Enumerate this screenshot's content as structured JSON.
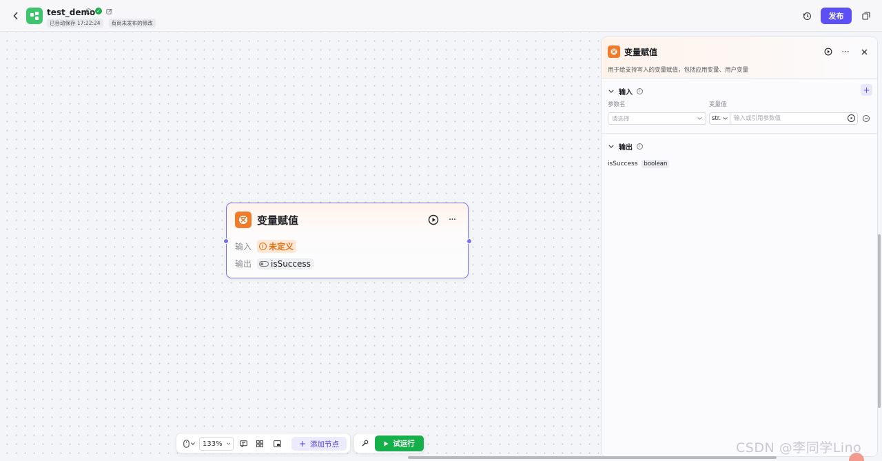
{
  "header": {
    "title": "test_demo",
    "autosave": "已自动保存 17:22:24",
    "unpublished": "有尚未发布的修改",
    "publish_label": "发布"
  },
  "node": {
    "title": "变量赋值",
    "input_label": "输入",
    "input_value": "未定义",
    "output_label": "输出",
    "output_value": "isSuccess"
  },
  "toolbar": {
    "zoom": "133%",
    "add_node_label": "添加节点",
    "trial_run_label": "试运行"
  },
  "panel": {
    "title": "变量赋值",
    "description": "用于给支持写入的变量赋值，包括应用变量、用户变量",
    "input_section": "输入",
    "param_name_header": "参数名",
    "param_value_header": "变量值",
    "param_name_placeholder": "请选择",
    "type_value": "str.",
    "value_placeholder": "输入或引用参数值",
    "output_section": "输出",
    "output_name": "isSuccess",
    "output_type": "boolean"
  },
  "watermark": "CSDN @李同学Lino",
  "colors": {
    "accent": "#5b4ff5",
    "node_icon": "#f07c2b",
    "run_green": "#16b04a",
    "warning": "#e8700f"
  }
}
